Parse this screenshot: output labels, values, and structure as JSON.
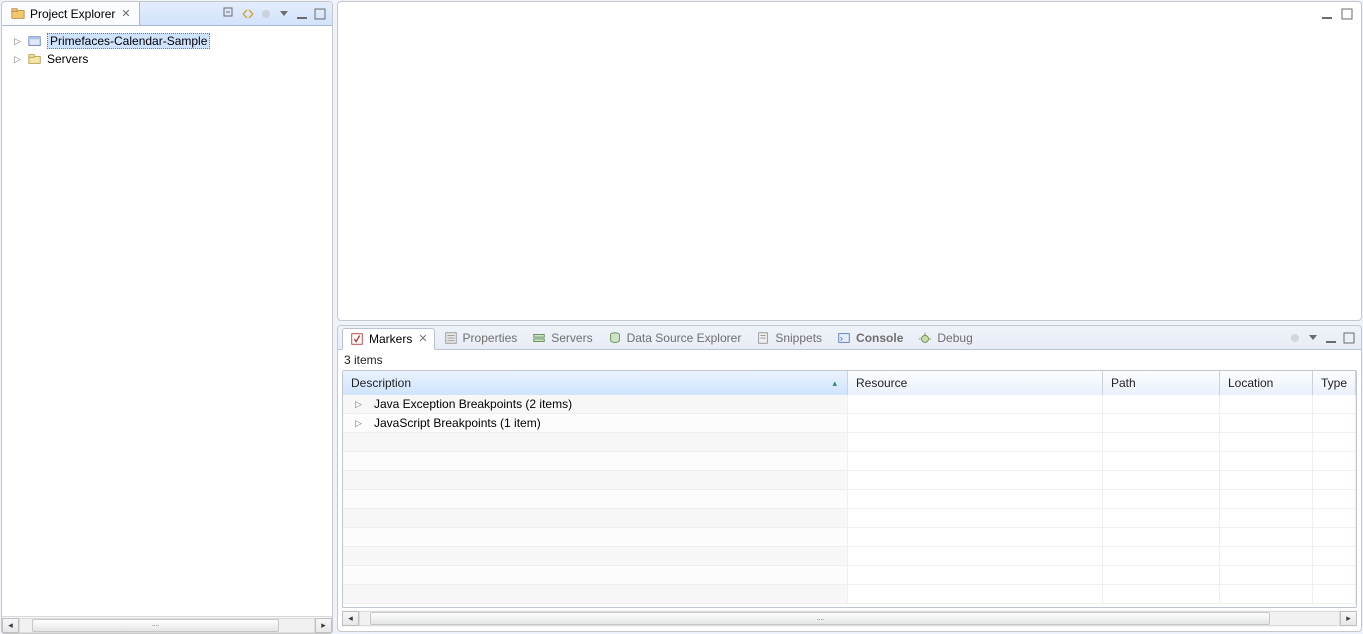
{
  "left": {
    "tab_title": "Project Explorer",
    "tree": [
      {
        "label": "Primefaces-Calendar-Sample",
        "selected": true,
        "icon": "project-icon"
      },
      {
        "label": "Servers",
        "selected": false,
        "icon": "folder-icon"
      }
    ]
  },
  "bottom": {
    "tabs": [
      {
        "label": "Markers",
        "icon": "markers-icon",
        "active": true,
        "closable": true,
        "bold": false
      },
      {
        "label": "Properties",
        "icon": "properties-icon",
        "active": false,
        "closable": false,
        "bold": false
      },
      {
        "label": "Servers",
        "icon": "servers-icon",
        "active": false,
        "closable": false,
        "bold": false
      },
      {
        "label": "Data Source Explorer",
        "icon": "datasource-icon",
        "active": false,
        "closable": false,
        "bold": false
      },
      {
        "label": "Snippets",
        "icon": "snippets-icon",
        "active": false,
        "closable": false,
        "bold": false
      },
      {
        "label": "Console",
        "icon": "console-icon",
        "active": false,
        "closable": false,
        "bold": true
      },
      {
        "label": "Debug",
        "icon": "debug-icon",
        "active": false,
        "closable": false,
        "bold": false
      }
    ],
    "count_label": "3 items",
    "columns": {
      "description": "Description",
      "resource": "Resource",
      "path": "Path",
      "location": "Location",
      "type": "Type"
    },
    "rows": [
      {
        "description": "Java Exception Breakpoints (2 items)"
      },
      {
        "description": "JavaScript Breakpoints (1 item)"
      }
    ]
  }
}
